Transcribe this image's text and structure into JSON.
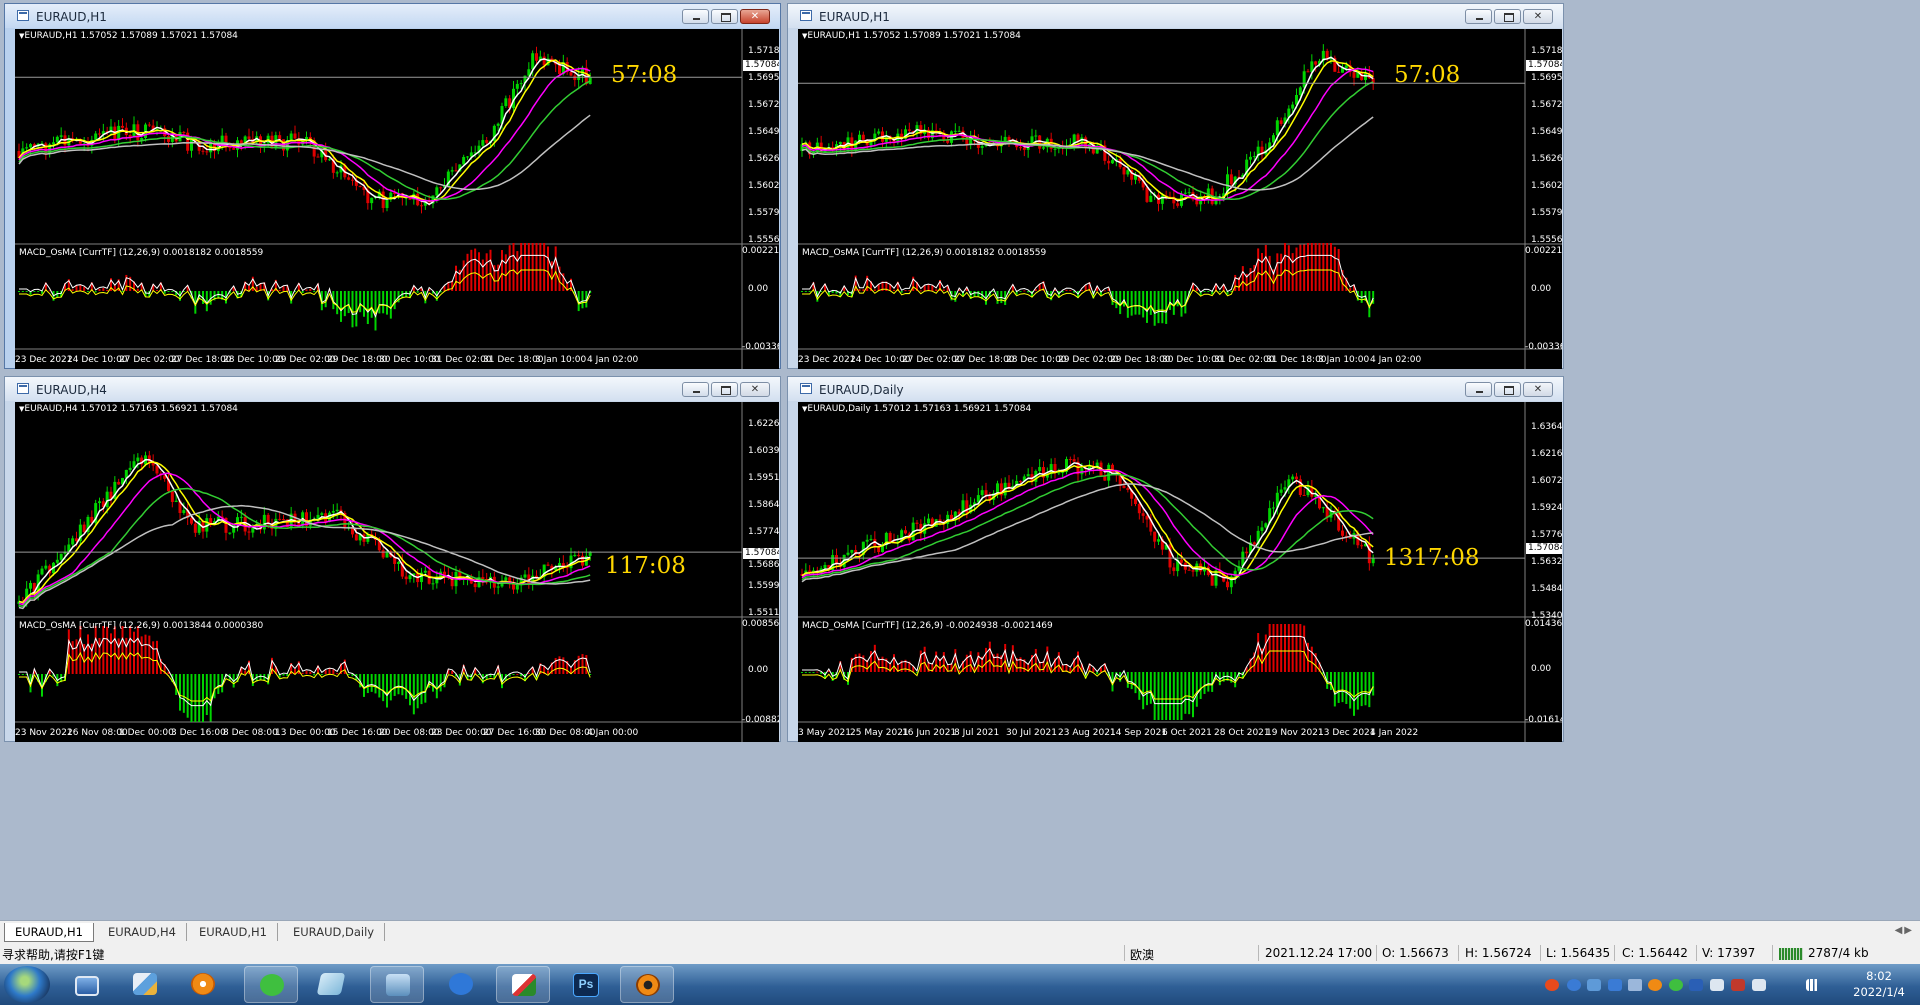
{
  "windows": [
    {
      "id": "w1",
      "title": "EURAUD,H1",
      "active": true,
      "symbol_line": "EURAUD,H1  1.57052 1.57089 1.57021 1.57084",
      "timer": "57:08",
      "macd_line": "MACD_OsMA [CurrTF] (12,26,9) 0.0018182 0.0018559",
      "price_labels": [
        "1.57180",
        "1.56950",
        "1.56720",
        "1.56490",
        "1.56260",
        "1.56025",
        "1.55795",
        "1.55565"
      ],
      "current_price": "1.57084",
      "macd_labels": [
        "0.0022136",
        "0.00",
        "-0.0033606"
      ],
      "time_labels": [
        "23 Dec 2021",
        "24 Dec 10:00",
        "27 Dec 02:00",
        "27 Dec 18:00",
        "28 Dec 10:00",
        "29 Dec 02:00",
        "29 Dec 18:00",
        "30 Dec 10:00",
        "31 Dec 02:00",
        "31 Dec 18:00",
        "3 Jan 10:00",
        "4 Jan 02:00"
      ]
    },
    {
      "id": "w2",
      "title": "EURAUD,H1",
      "active": false,
      "symbol_line": "EURAUD,H1  1.57052 1.57089 1.57021 1.57084",
      "timer": "57:08",
      "macd_line": "MACD_OsMA [CurrTF] (12,26,9) 0.0018182 0.0018559",
      "price_labels": [
        "1.57180",
        "1.56950",
        "1.56720",
        "1.56490",
        "1.56260",
        "1.56025",
        "1.55795",
        "1.55565"
      ],
      "current_price": "1.57084",
      "macd_labels": [
        "0.0022136",
        "0.00",
        "-0.0033606"
      ],
      "time_labels": [
        "23 Dec 2021",
        "24 Dec 10:00",
        "27 Dec 02:00",
        "27 Dec 18:00",
        "28 Dec 10:00",
        "29 Dec 02:00",
        "29 Dec 18:00",
        "30 Dec 10:00",
        "31 Dec 02:00",
        "31 Dec 18:00",
        "3 Jan 10:00",
        "4 Jan 02:00"
      ]
    },
    {
      "id": "w3",
      "title": "EURAUD,H4",
      "active": false,
      "symbol_line": "EURAUD,H4  1.57012 1.57163 1.56921 1.57084",
      "timer": "117:08",
      "macd_line": "MACD_OsMA [CurrTF] (12,26,9) 0.0013844 0.0000380",
      "price_labels": [
        "1.62265",
        "1.60390",
        "1.59515",
        "1.58640",
        "1.57740",
        "1.56865",
        "1.55990",
        "1.55115"
      ],
      "current_price": "1.57084",
      "macd_labels": [
        "0.0085675",
        "0.00",
        "-0.0088294"
      ],
      "time_labels": [
        "23 Nov 2021",
        "26 Nov 08:00",
        "1 Dec 00:00",
        "3 Dec 16:00",
        "8 Dec 08:00",
        "13 Dec 00:00",
        "15 Dec 16:00",
        "20 Dec 08:00",
        "23 Dec 00:00",
        "27 Dec 16:00",
        "30 Dec 08:00",
        "4 Jan 00:00"
      ]
    },
    {
      "id": "w4",
      "title": "EURAUD,Daily",
      "active": false,
      "symbol_line": "EURAUD,Daily  1.57012 1.57163 1.56921 1.57084",
      "timer": "1317:08",
      "macd_line": "MACD_OsMA [CurrTF] (12,26,9) -0.0024938 -0.0021469",
      "price_labels": [
        "1.63640",
        "1.62160",
        "1.60720",
        "1.59240",
        "1.57760",
        "1.56320",
        "1.54840",
        "1.53400"
      ],
      "current_price": "1.57084",
      "macd_labels": [
        "0.0143607",
        "0.00",
        "-0.0161448"
      ],
      "time_labels": [
        "3 May 2021",
        "25 May 2021",
        "16 Jun 2021",
        "8 Jul 2021",
        "30 Jul 2021",
        "23 Aug 2021",
        "14 Sep 2021",
        "6 Oct 2021",
        "28 Oct 2021",
        "19 Nov 2021",
        "13 Dec 2021",
        "4 Jan 2022"
      ]
    }
  ],
  "tabs": [
    "EURAUD,H1",
    "EURAUD,H4",
    "EURAUD,H1",
    "EURAUD,Daily"
  ],
  "status": {
    "help": "寻求帮助,请按F1键",
    "profile": "欧澳",
    "datetime": "2021.12.24 17:00",
    "open": "O: 1.56673",
    "high": "H: 1.56724",
    "low": "L: 1.56435",
    "close": "C: 1.56442",
    "volume": "V: 17397",
    "traffic": "2787/4 kb"
  },
  "taskbar": {
    "time": "8:02",
    "date": "2022/1/4",
    "apps": [
      "monitor-app",
      "control-panel-app",
      "orange-swirl-app",
      "wechat-app",
      "notes-app",
      "network-app",
      "pen-app",
      "paint-app",
      "photoshop-app",
      "trader-app"
    ],
    "photoshop_label": "Ps"
  },
  "colors": {
    "bull": "#00d400",
    "bear": "#e00000",
    "ma_fast": "#ffffff",
    "ma_yellow": "#ffff00",
    "ma_magenta": "#ff00ff",
    "ma_green": "#32cd32",
    "ma_gray": "#c0c0c0",
    "timer": "#ffd700"
  }
}
